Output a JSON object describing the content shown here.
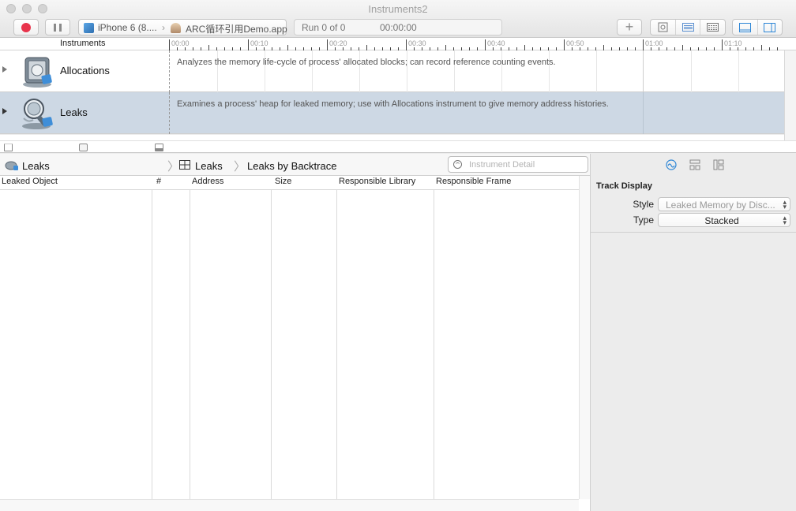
{
  "window": {
    "title": "Instruments2"
  },
  "toolbar": {
    "device": "iPhone 6 (8....",
    "app": "ARC循环引用Demo.app",
    "run": "Run 0 of 0",
    "time": "00:00:00",
    "add_label": "+"
  },
  "tracks_header": {
    "label": "Instruments",
    "ticks": [
      "00:00",
      "00:10",
      "00:20",
      "00:30",
      "00:40",
      "00:50",
      "01:00",
      "01:10"
    ]
  },
  "tracks": [
    {
      "name": "Allocations",
      "description": "Analyzes the memory life-cycle of process' allocated blocks; can record reference counting events.",
      "selected": false
    },
    {
      "name": "Leaks",
      "description": "Examines a process' heap for leaked memory; use with Allocations instrument to give memory address histories.",
      "selected": true
    }
  ],
  "detail_nav": {
    "instrument": "Leaks",
    "view": "Leaks",
    "subview": "Leaks by Backtrace",
    "search_placeholder": "Instrument Detail"
  },
  "table": {
    "columns": [
      "Leaked Object",
      "#",
      "Address",
      "Size",
      "Responsible Library",
      "Responsible Frame"
    ],
    "rows": []
  },
  "inspector": {
    "section_title": "Track Display",
    "style_label": "Style",
    "style_value": "Leaked Memory by Disc...",
    "type_label": "Type",
    "type_value": "Stacked"
  },
  "colors": {
    "record": "#e8344c",
    "selected_track": "#cdd8e4",
    "accent": "#2d86d6"
  }
}
